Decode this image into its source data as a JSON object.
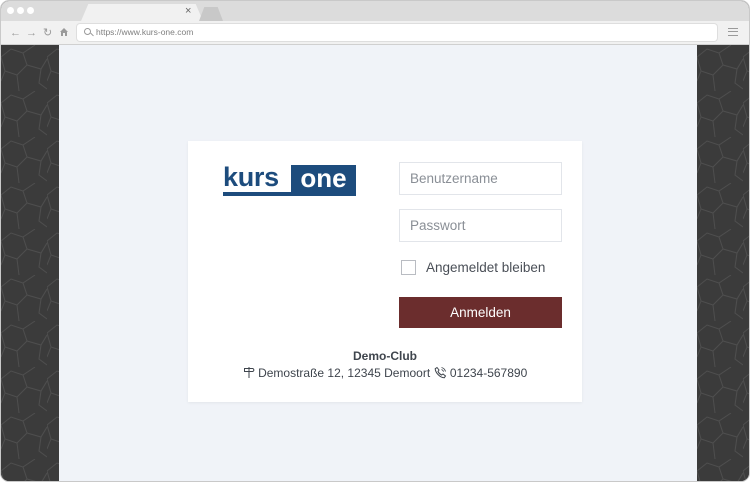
{
  "browser": {
    "tab_close": "×",
    "url": "https://www.kurs-one.com",
    "nav_icons": [
      "back-arrow-icon",
      "forward-arrow-icon",
      "reload-icon",
      "home-icon"
    ]
  },
  "login": {
    "logo": {
      "word_left": "kurs",
      "word_right": "one",
      "color": "#1d4c7d"
    },
    "username_placeholder": "Benutzername",
    "password_placeholder": "Passwort",
    "remember_label": "Angemeldet bleiben",
    "remember_checked": false,
    "submit_label": "Anmelden",
    "submit_color": "#6b2d2d"
  },
  "club": {
    "name": "Demo-Club",
    "address": "Demostraße 12, 12345 Demoort",
    "phone": "01234-567890",
    "address_icon": "signpost-icon",
    "phone_icon": "phone-icon"
  }
}
